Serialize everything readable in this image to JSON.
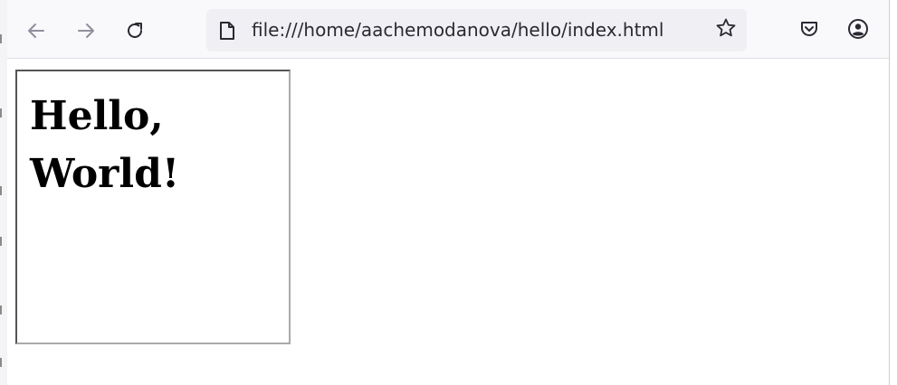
{
  "browser": {
    "toolbar": {
      "back_icon": "arrow-left-icon",
      "forward_icon": "arrow-right-icon",
      "reload_icon": "reload-icon",
      "page_icon": "document-icon",
      "bookmark_icon": "star-icon",
      "pocket_icon": "pocket-icon",
      "account_icon": "account-icon"
    },
    "url": "file:///home/aachemodanova/hello/index.html"
  },
  "page": {
    "heading_line1": "Hello,",
    "heading_line2": "World!"
  },
  "colors": {
    "toolbar_bg": "#f9f9fb",
    "urlbar_bg": "#f0f0f4",
    "icon_color": "#2b2a33",
    "disabled_icon_color": "#8f8f9d",
    "page_bg": "#ffffff",
    "heading_color": "#000000"
  }
}
